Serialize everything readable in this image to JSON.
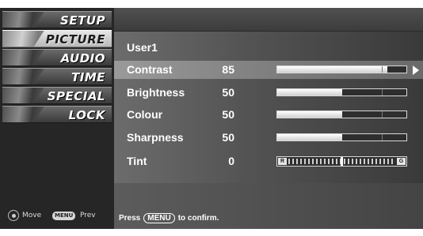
{
  "sidebar": {
    "items": [
      {
        "label": "SETUP",
        "active": false,
        "icon": "setup-icon"
      },
      {
        "label": "PICTURE",
        "active": true,
        "icon": "picture-icon"
      },
      {
        "label": "AUDIO",
        "active": false,
        "icon": "audio-icon"
      },
      {
        "label": "TIME",
        "active": false,
        "icon": "time-icon"
      },
      {
        "label": "SPECIAL",
        "active": false,
        "icon": "special-icon"
      },
      {
        "label": "LOCK",
        "active": false,
        "icon": "lock-icon"
      }
    ],
    "footer": {
      "move_label": "Move",
      "menu_key": "MENU",
      "prev_label": "Prev",
      "move_icon": "dpad-icon"
    }
  },
  "panel": {
    "title": "User1",
    "rows": [
      {
        "label": "Contrast",
        "value": "85",
        "level": 0.85,
        "selected": true
      },
      {
        "label": "Brightness",
        "value": "50",
        "level": 0.5,
        "selected": false
      },
      {
        "label": "Colour",
        "value": "50",
        "level": 0.5,
        "selected": false
      },
      {
        "label": "Sharpness",
        "value": "50",
        "level": 0.5,
        "selected": false
      }
    ],
    "tint": {
      "label": "Tint",
      "value": "0",
      "left_end": "R",
      "right_end": "G"
    },
    "footer": {
      "press": "Press",
      "menu_key": "MENU",
      "confirm": "to confirm."
    }
  },
  "colors": {
    "sidebar_bg": "#262626",
    "panel_bg": "#525252",
    "selected_row": "#8c8c8c",
    "text": "#ffffff"
  }
}
